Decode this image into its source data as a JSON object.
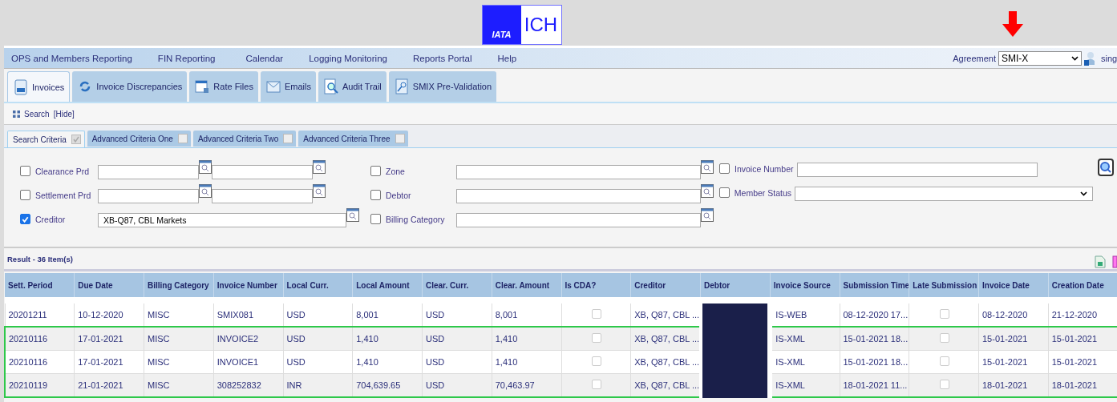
{
  "header": {
    "logo": {
      "left": "IATA",
      "right": "ICH"
    }
  },
  "menu": [
    {
      "label": "OPS and Members Reporting"
    },
    {
      "label": "FIN Reporting"
    },
    {
      "label": "Calendar"
    },
    {
      "label": "Logging Monitoring"
    },
    {
      "label": "Reports Portal"
    },
    {
      "label": "Help"
    }
  ],
  "agreement": {
    "label": "Agreement",
    "value": "SMI-X",
    "user": "sing"
  },
  "tabs": [
    {
      "label": "Invoices",
      "selected": true
    },
    {
      "label": "Invoice Discrepancies",
      "selected": false
    },
    {
      "label": "Rate Files",
      "selected": false
    },
    {
      "label": "Emails",
      "selected": false
    },
    {
      "label": "Audit Trail",
      "selected": false
    },
    {
      "label": "SMIX Pre-Validation",
      "selected": false
    }
  ],
  "search_toggle": {
    "label": "Search",
    "link": "[Hide]"
  },
  "criteria_tabs": [
    {
      "label": "Search Criteria",
      "selected": true,
      "checked": true
    },
    {
      "label": "Advanced Criteria One",
      "selected": false,
      "checked": false
    },
    {
      "label": "Advanced Criteria Two",
      "selected": false,
      "checked": false
    },
    {
      "label": "Advanced Criteria Three",
      "selected": false,
      "checked": false
    }
  ],
  "form": {
    "columns": [
      [
        {
          "label": "Clearance Prd",
          "checked": false,
          "kind": "range"
        },
        {
          "label": "Settlement Prd",
          "checked": false,
          "kind": "range"
        },
        {
          "label": "Creditor",
          "checked": true,
          "kind": "lookup",
          "value": "XB-Q87, CBL Markets"
        }
      ],
      [
        {
          "label": "Zone",
          "checked": false,
          "kind": "lookup"
        },
        {
          "label": "Debtor",
          "checked": false,
          "kind": "lookup"
        },
        {
          "label": "Billing Category",
          "checked": false,
          "kind": "lookup"
        }
      ],
      [
        {
          "label": "Invoice Number",
          "checked": false,
          "kind": "text"
        },
        {
          "label": "Member Status",
          "checked": false,
          "kind": "select"
        }
      ]
    ]
  },
  "result": {
    "title": "Result - 36 Item(s)"
  },
  "table": {
    "columns": [
      {
        "label": "Sett. Period",
        "kind": "text"
      },
      {
        "label": "Due Date",
        "kind": "text"
      },
      {
        "label": "Billing Category",
        "kind": "text"
      },
      {
        "label": "Invoice Number",
        "kind": "text"
      },
      {
        "label": "Local Curr.",
        "kind": "text"
      },
      {
        "label": "Local Amount",
        "kind": "text"
      },
      {
        "label": "Clear. Curr.",
        "kind": "text"
      },
      {
        "label": "Clear. Amount",
        "kind": "text"
      },
      {
        "label": "Is CDA?",
        "kind": "cda"
      },
      {
        "label": "Creditor",
        "kind": "text"
      },
      {
        "label": "Debtor",
        "kind": "debtor"
      },
      {
        "label": "Invoice Source",
        "kind": "text"
      },
      {
        "label": "Submission Time",
        "kind": "text"
      },
      {
        "label": "Late Submission",
        "kind": "late"
      },
      {
        "label": "Invoice Date",
        "kind": "text"
      },
      {
        "label": "Creation Date",
        "kind": "text"
      }
    ],
    "rows": [
      {
        "cells": [
          "20201211",
          "10-12-2020",
          "MISC",
          "SMIX081",
          "USD",
          "8,001",
          "USD",
          "8,001",
          {
            "checked": false
          },
          "XB, Q87, CBL ...",
          {
            "redacted": true
          },
          "IS-WEB",
          "08-12-2020 17...",
          {
            "checked": false
          },
          "08-12-2020",
          "21-12-2020"
        ],
        "highlighted": false
      },
      {
        "cells": [
          "20210116",
          "17-01-2021",
          "MISC",
          "INVOICE2",
          "USD",
          "1,410",
          "USD",
          "1,410",
          {
            "checked": false
          },
          "XB, Q87, CBL ...",
          {
            "redacted": true
          },
          "IS-XML",
          "15-01-2021 18...",
          {
            "checked": false
          },
          "15-01-2021",
          "15-01-2021"
        ],
        "highlighted": true
      },
      {
        "cells": [
          "20210116",
          "17-01-2021",
          "MISC",
          "INVOICE1",
          "USD",
          "1,410",
          "USD",
          "1,410",
          {
            "checked": false
          },
          "XB, Q87, CBL ...",
          {
            "redacted": true
          },
          "IS-XML",
          "15-01-2021 18...",
          {
            "checked": false
          },
          "15-01-2021",
          "15-01-2021"
        ],
        "highlighted": true
      },
      {
        "cells": [
          "20210119",
          "21-01-2021",
          "MISC",
          "308252832",
          "INR",
          "704,639.65",
          "USD",
          "70,463.97",
          {
            "checked": false
          },
          "XB, Q87, CBL ...",
          {
            "redacted": true
          },
          "IS-XML",
          "18-01-2021 11...",
          {
            "checked": false
          },
          "18-01-2021",
          "18-01-2021"
        ],
        "highlighted": true
      }
    ]
  }
}
